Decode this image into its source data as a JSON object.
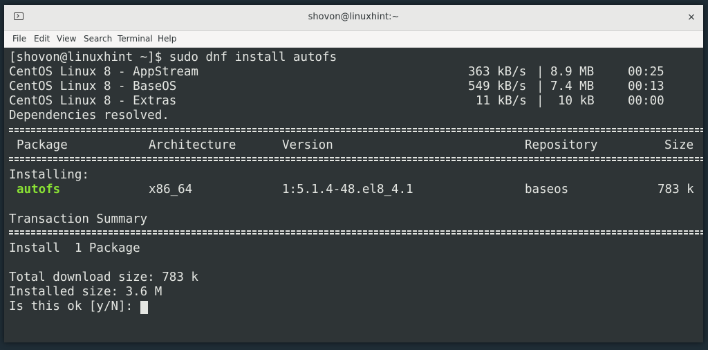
{
  "window": {
    "title": "shovon@linuxhint:~",
    "close_label": "×"
  },
  "menu": [
    "File",
    "Edit",
    "View",
    "Search",
    "Terminal",
    "Help"
  ],
  "terminal": {
    "prompt_line": "[shovon@linuxhint ~]$ sudo dnf install autofs",
    "repos": [
      {
        "name": "CentOS Linux 8 - AppStream",
        "speed": "363 kB/s",
        "sep": "|",
        "size": "8.9 MB",
        "time": "00:25"
      },
      {
        "name": "CentOS Linux 8 - BaseOS",
        "speed": "549 kB/s",
        "sep": "|",
        "size": "7.4 MB",
        "time": "00:13"
      },
      {
        "name": "CentOS Linux 8 - Extras",
        "speed": "11 kB/s",
        "sep": "|",
        "size": "10 kB",
        "time": "00:00"
      }
    ],
    "deps": "Dependencies resolved.",
    "headers": {
      "package": "Package",
      "arch": "Architecture",
      "version": "Version",
      "repo": "Repository",
      "size": "Size"
    },
    "installing_label": "Installing:",
    "pkg": {
      "name": "autofs",
      "arch": "x86_64",
      "version": "1:5.1.4-48.el8_4.1",
      "repo": "baseos",
      "size": "783 k"
    },
    "summary_title": "Transaction Summary",
    "install_line": "Install  1 Package",
    "download_size": "Total download size: 783 k",
    "installed_size": "Installed size: 3.6 M",
    "confirm_prompt": "Is this ok [y/N]: "
  },
  "colors": {
    "terminal_bg": "#2e3436",
    "text": "#e4e6e2",
    "highlight": "#8ae234"
  }
}
